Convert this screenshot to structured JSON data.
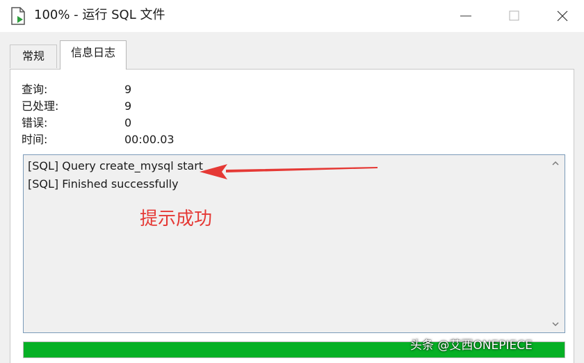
{
  "window": {
    "title": "100% - 运行 SQL 文件",
    "icon": "sql-file-run-icon",
    "controls": {
      "minimize_icon": "minimize-icon",
      "maximize_icon": "maximize-icon",
      "close_icon": "close-icon"
    }
  },
  "tabs": [
    {
      "label": "常规",
      "active": false
    },
    {
      "label": "信息日志",
      "active": true
    }
  ],
  "stats": [
    {
      "label": "查询:",
      "value": "9"
    },
    {
      "label": "已处理:",
      "value": "9"
    },
    {
      "label": "错误:",
      "value": "0"
    },
    {
      "label": "时间:",
      "value": "00:00.03"
    }
  ],
  "log": {
    "lines": [
      "[SQL] Query create_mysql start",
      "[SQL] Finished successfully"
    ]
  },
  "annotation": {
    "text": "提示成功",
    "color": "#e53935"
  },
  "progress": {
    "percent": 100,
    "color": "#06b025"
  },
  "watermark": "头条 @艾西ONEPIECE"
}
